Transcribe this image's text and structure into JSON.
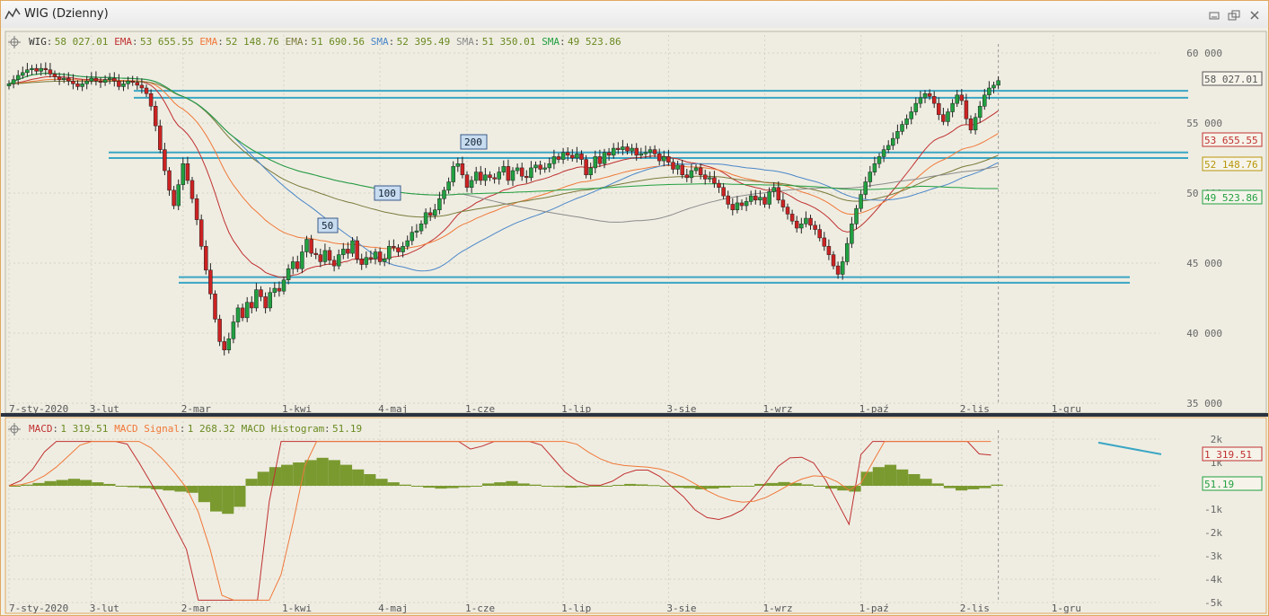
{
  "window": {
    "title": "WIG (Dzienny)"
  },
  "colors": {
    "wig": "#333333",
    "ema53": "#c03030",
    "ema52": "#f07838",
    "ema51": "#7a7a3a",
    "sma52": "#4a86c8",
    "sma51": "#8a8a8a",
    "sma49": "#21a040",
    "hline": "#3aa6c4",
    "up": "#21a040",
    "down": "#cc2222",
    "macd": "#c03030",
    "signal": "#f07838",
    "hist": "#7a9a30"
  },
  "price_legend": [
    {
      "name": "WIG",
      "value": "58 027.01",
      "color": "#333333"
    },
    {
      "name": "EMA",
      "value": "53 655.55",
      "color": "#c03030"
    },
    {
      "name": "EMA",
      "value": "52 148.76",
      "color": "#f07838"
    },
    {
      "name": "EMA",
      "value": "51 690.56",
      "color": "#7a7a3a"
    },
    {
      "name": "SMA",
      "value": "52 395.49",
      "color": "#4a86c8"
    },
    {
      "name": "SMA",
      "value": "51 350.01",
      "color": "#8a8a8a"
    },
    {
      "name": "SMA",
      "value": "49 523.86",
      "color": "#21a040"
    }
  ],
  "price_badges": [
    {
      "value": "58 027.01",
      "color": "#555555"
    },
    {
      "value": "53 655.55",
      "color": "#c03030"
    },
    {
      "value": "52 148.76",
      "color": "#b8960a"
    },
    {
      "value": "49 523.86",
      "color": "#21a040"
    }
  ],
  "macd_legend": [
    {
      "name": "MACD",
      "value": "1 319.51",
      "color": "#c03030"
    },
    {
      "name": "MACD Signal",
      "value": "1 268.32",
      "color": "#f07838"
    },
    {
      "name": "MACD Histogram",
      "value": "51.19",
      "color": "#6a8a20"
    }
  ],
  "macd_badges": [
    {
      "value": "1 319.51",
      "color": "#c03030"
    },
    {
      "value": "51.19",
      "color": "#21a040"
    }
  ],
  "ma_labels": [
    "200",
    "100",
    "50"
  ],
  "chart_data": [
    {
      "type": "candlestick",
      "title": "WIG (Dzienny)",
      "ylim": [
        35000,
        60000
      ],
      "yticks": [
        "60 000",
        "55 000",
        "50 000",
        "45 000",
        "40 000",
        "35 000"
      ],
      "x_tick_labels": [
        "7-sty-2020",
        "3-lut",
        "2-mar",
        "1-kwi",
        "4-maj",
        "1-cze",
        "1-lip",
        "3-sie",
        "1-wrz",
        "1-paź",
        "2-lis",
        "1-gru"
      ],
      "x_tick_index": [
        0,
        18,
        38,
        60,
        81,
        100,
        121,
        144,
        165,
        186,
        208,
        228
      ],
      "horizontal_levels": [
        57300,
        56800,
        52900,
        52500,
        44000,
        43600
      ],
      "close": [
        57800,
        58100,
        58400,
        58600,
        58800,
        58900,
        58700,
        58900,
        58800,
        58500,
        58300,
        58100,
        58200,
        58000,
        57800,
        57600,
        57800,
        58000,
        58200,
        58000,
        57900,
        58100,
        58200,
        58000,
        57600,
        57800,
        58000,
        57900,
        57700,
        57500,
        57100,
        56200,
        54800,
        53100,
        51600,
        50200,
        49100,
        50600,
        52100,
        50900,
        49600,
        48100,
        46200,
        44500,
        42800,
        41000,
        39400,
        38800,
        39600,
        40800,
        41800,
        41100,
        42200,
        41800,
        43100,
        42600,
        41800,
        42900,
        43200,
        43000,
        43800,
        44600,
        45100,
        44600,
        45800,
        46700,
        45700,
        45600,
        45100,
        45900,
        45200,
        44800,
        45600,
        46000,
        45700,
        46600,
        45300,
        44900,
        45400,
        45300,
        45800,
        45100,
        45300,
        46200,
        46100,
        45800,
        46200,
        46600,
        47200,
        47300,
        47800,
        48600,
        48400,
        48800,
        49600,
        50200,
        50800,
        51900,
        52100,
        51300,
        50400,
        50900,
        51500,
        50900,
        51300,
        51100,
        51000,
        51500,
        51900,
        50900,
        51600,
        51800,
        51200,
        51100,
        51800,
        52000,
        51700,
        51800,
        52100,
        52600,
        52400,
        52900,
        52700,
        52500,
        52800,
        52400,
        51300,
        51800,
        52600,
        52100,
        52900,
        52700,
        53200,
        53100,
        53300,
        53000,
        53200,
        52700,
        52800,
        52900,
        53100,
        52800,
        52300,
        52600,
        52200,
        51700,
        52000,
        51300,
        51100,
        51600,
        51800,
        51300,
        51000,
        51100,
        50700,
        50400,
        49800,
        49200,
        48800,
        49300,
        49100,
        49400,
        49800,
        49500,
        49700,
        49200,
        50100,
        50400,
        49500,
        49000,
        48500,
        48000,
        47500,
        47800,
        48200,
        47700,
        47400,
        46800,
        46200,
        45600,
        44800,
        44200,
        45100,
        46400,
        47800,
        48900,
        49900,
        50800,
        51500,
        52100,
        52600,
        53100,
        53400,
        53900,
        54400,
        54900,
        55300,
        55800,
        56400,
        56800,
        57100,
        56900,
        56400,
        55600,
        55100,
        55800,
        56400,
        57000,
        56600,
        55300,
        54500,
        55400,
        56200,
        57000,
        57500,
        57700,
        58027
      ],
      "ema53_end": 53655.55,
      "ema52_end": 52148.76,
      "ema51_end": 51690.56,
      "sma52_end": 52395.49,
      "sma51_end": 51350.01,
      "sma49_end": 49523.86
    },
    {
      "type": "line+bar",
      "title": "MACD",
      "ylim": [
        -5000,
        2000
      ],
      "yticks": [
        "2k",
        "1k",
        "0k",
        "-1k",
        "-2k",
        "-3k",
        "-4k",
        "-5k"
      ],
      "series": [
        {
          "name": "MACD",
          "last": 1319.51
        },
        {
          "name": "MACD Signal",
          "last": 1268.32
        },
        {
          "name": "MACD Histogram",
          "last": 51.19
        }
      ],
      "hist_sample": [
        0,
        50,
        120,
        200,
        250,
        300,
        250,
        150,
        80,
        0,
        -60,
        -100,
        -150,
        -200,
        -250,
        -300,
        -700,
        -1100,
        -1200,
        -900,
        300,
        600,
        800,
        900,
        1000,
        1100,
        1200,
        1100,
        900,
        700,
        500,
        300,
        150,
        50,
        0,
        -80,
        -120,
        -100,
        -60,
        0,
        100,
        150,
        200,
        100,
        50,
        0,
        -50,
        -80,
        -60,
        -30,
        0,
        40,
        80,
        60,
        30,
        -30,
        -80,
        -100,
        -150,
        -120,
        -80,
        -30,
        0,
        80,
        120,
        160,
        120,
        60,
        0,
        -120,
        -200,
        -250,
        600,
        800,
        900,
        700,
        500,
        300,
        100,
        -100,
        -200,
        -150,
        -100,
        51
      ]
    }
  ]
}
